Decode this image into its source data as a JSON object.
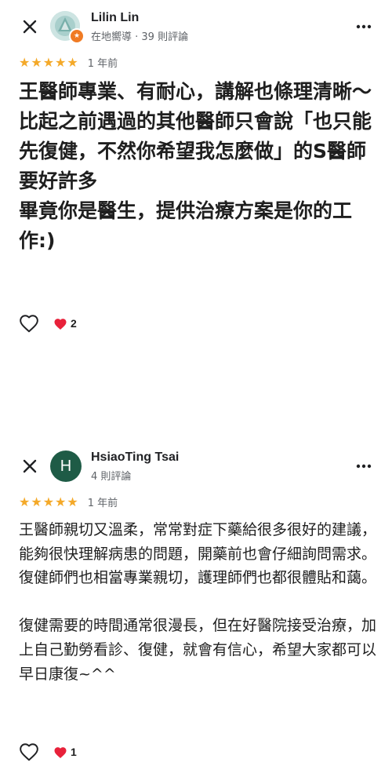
{
  "reviews": [
    {
      "author": "Lilin Lin",
      "meta": "在地嚮導 · 39 則評論",
      "rating": 5,
      "date": "1 年前",
      "text": "王醫師專業、有耐心，講解也條理清晰～\n比起之前遇過的其他醫師只會說「也只能先復健，不然你希望我怎麼做」的S醫師要好許多\n畢竟你是醫生，提供治療方案是你的工作:)",
      "reaction_count": "2"
    },
    {
      "author": "HsiaoTing Tsai",
      "avatar_letter": "H",
      "meta": "4 則評論",
      "rating": 5,
      "date": "1 年前",
      "text": "王醫師親切又溫柔，常常對症下藥給很多很好的建議，能夠很快理解病患的問題，開藥前也會仔細詢問需求。復健師們也相當專業親切，護理師們也都很體貼和藹。\n\n復健需要的時間通常很漫長，但在好醫院接受治療，加上自己勤勞看診、復健，就會有信心，希望大家都可以早日康復~^^",
      "reaction_count": "1"
    }
  ],
  "icons": {
    "close": "close-icon",
    "more": "more-vert-icon",
    "like": "heart-outline-icon",
    "reaction": "red-heart-icon",
    "local_guide": "local-guide-star-icon"
  },
  "colors": {
    "star": "#f4a929",
    "badge": "#f07b24",
    "avatar2": "#1e5b46",
    "heart": "#e8213a"
  }
}
